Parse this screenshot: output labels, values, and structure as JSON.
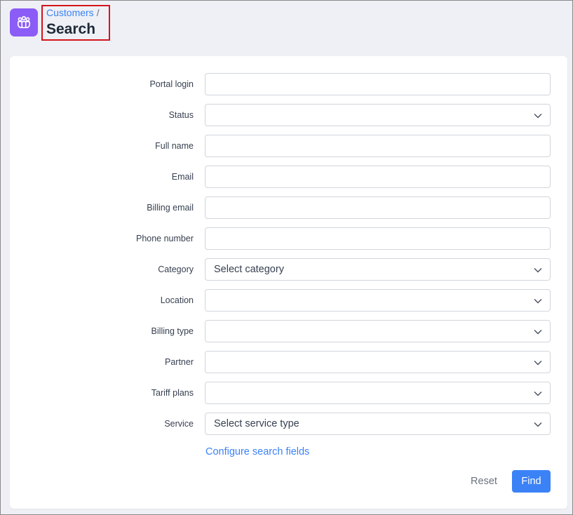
{
  "header": {
    "icon": "customers-group-icon",
    "accent_color": "#8b5cf6",
    "breadcrumb_parent": "Customers",
    "breadcrumb_separator": "/",
    "title": "Search"
  },
  "form": {
    "fields": [
      {
        "label": "Portal login",
        "type": "text",
        "value": ""
      },
      {
        "label": "Status",
        "type": "select",
        "value": ""
      },
      {
        "label": "Full name",
        "type": "text",
        "value": ""
      },
      {
        "label": "Email",
        "type": "text",
        "value": ""
      },
      {
        "label": "Billing email",
        "type": "text",
        "value": ""
      },
      {
        "label": "Phone number",
        "type": "text",
        "value": ""
      },
      {
        "label": "Category",
        "type": "select",
        "value": "Select category"
      },
      {
        "label": "Location",
        "type": "select",
        "value": ""
      },
      {
        "label": "Billing type",
        "type": "select",
        "value": ""
      },
      {
        "label": "Partner",
        "type": "select",
        "value": ""
      },
      {
        "label": "Tariff plans",
        "type": "select",
        "value": ""
      },
      {
        "label": "Service",
        "type": "select",
        "value": "Select service type"
      }
    ],
    "configure_link": "Configure search fields",
    "reset_label": "Reset",
    "find_label": "Find",
    "primary_color": "#3b82f6"
  }
}
